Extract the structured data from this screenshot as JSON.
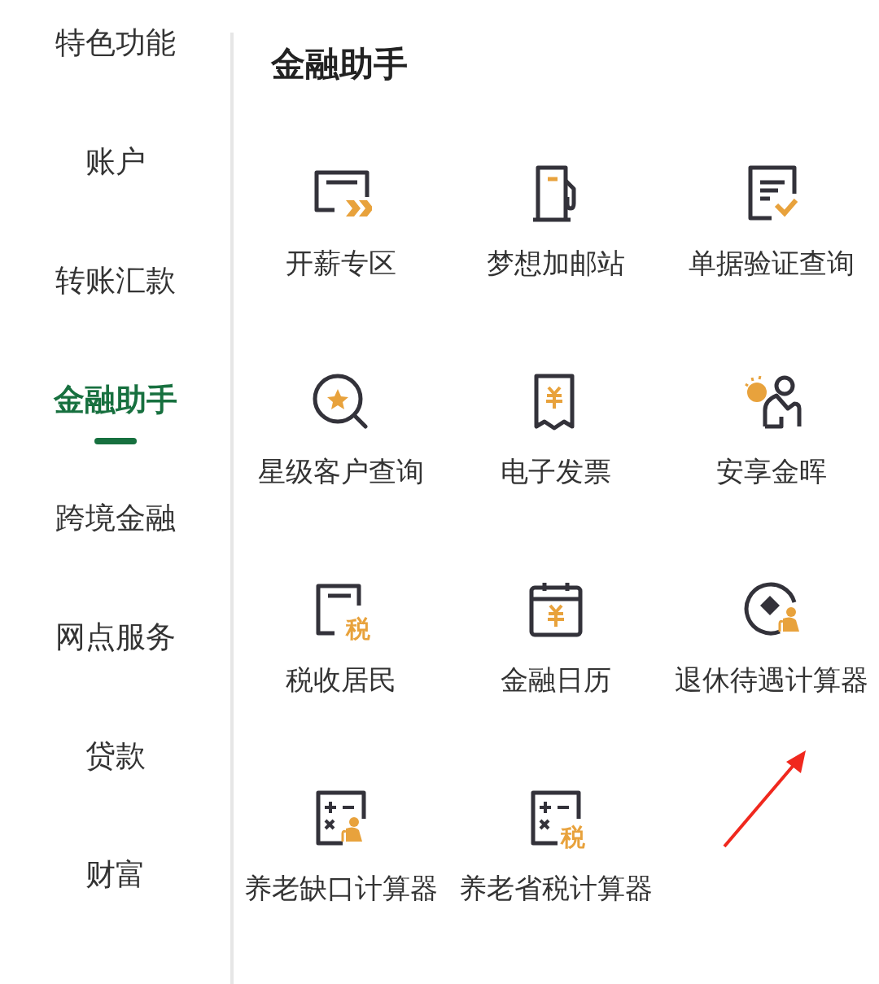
{
  "sidebar": {
    "items": [
      {
        "label": "特色功能",
        "selected": false
      },
      {
        "label": "账户",
        "selected": false
      },
      {
        "label": "转账汇款",
        "selected": false
      },
      {
        "label": "金融助手",
        "selected": true
      },
      {
        "label": "跨境金融",
        "selected": false
      },
      {
        "label": "网点服务",
        "selected": false
      },
      {
        "label": "贷款",
        "selected": false
      },
      {
        "label": "财富",
        "selected": false
      }
    ]
  },
  "section": {
    "title": "金融助手",
    "items": [
      {
        "label": "开薪专区",
        "kind": "card-arrows"
      },
      {
        "label": "梦想加邮站",
        "kind": "fuel-pump"
      },
      {
        "label": "单据验证查询",
        "kind": "doc-check"
      },
      {
        "label": "星级客户查询",
        "kind": "search-star"
      },
      {
        "label": "电子发票",
        "kind": "receipt-yen"
      },
      {
        "label": "安享金晖",
        "kind": "person-sun"
      },
      {
        "label": "税收居民",
        "kind": "doc-tax",
        "icon_text": "税"
      },
      {
        "label": "金融日历",
        "kind": "calendar-yen"
      },
      {
        "label": "退休待遇计算器",
        "kind": "coin-elder"
      },
      {
        "label": "养老缺口计算器",
        "kind": "calc-elder"
      },
      {
        "label": "养老省税计算器",
        "kind": "calc-tax",
        "icon_text": "税"
      }
    ]
  }
}
